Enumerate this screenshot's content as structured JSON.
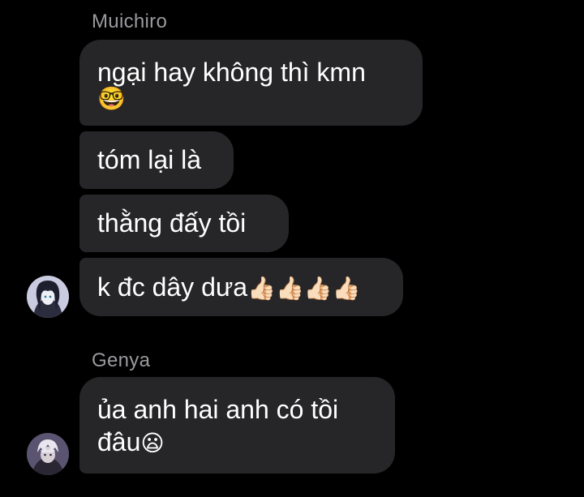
{
  "groups": [
    {
      "sender": "Muichiro",
      "messages": [
        {
          "lines": [
            "ngại hay không thì kmn"
          ],
          "emoji": "🤓"
        },
        {
          "lines": [
            "tóm lại là"
          ]
        },
        {
          "lines": [
            "thằng đấy tồi"
          ]
        },
        {
          "lines": [
            "k đc dây dưa"
          ],
          "emoji": "👍🏻👍🏻👍🏻👍🏻"
        }
      ]
    },
    {
      "sender": "Genya",
      "messages": [
        {
          "lines": [
            "ủa anh hai anh có tồi",
            "đâu"
          ],
          "emoji": "😦"
        }
      ]
    }
  ],
  "colors": {
    "background": "#000000",
    "bubble": "#262628",
    "sender_name": "#9a9a9f",
    "text": "#ffffff"
  }
}
